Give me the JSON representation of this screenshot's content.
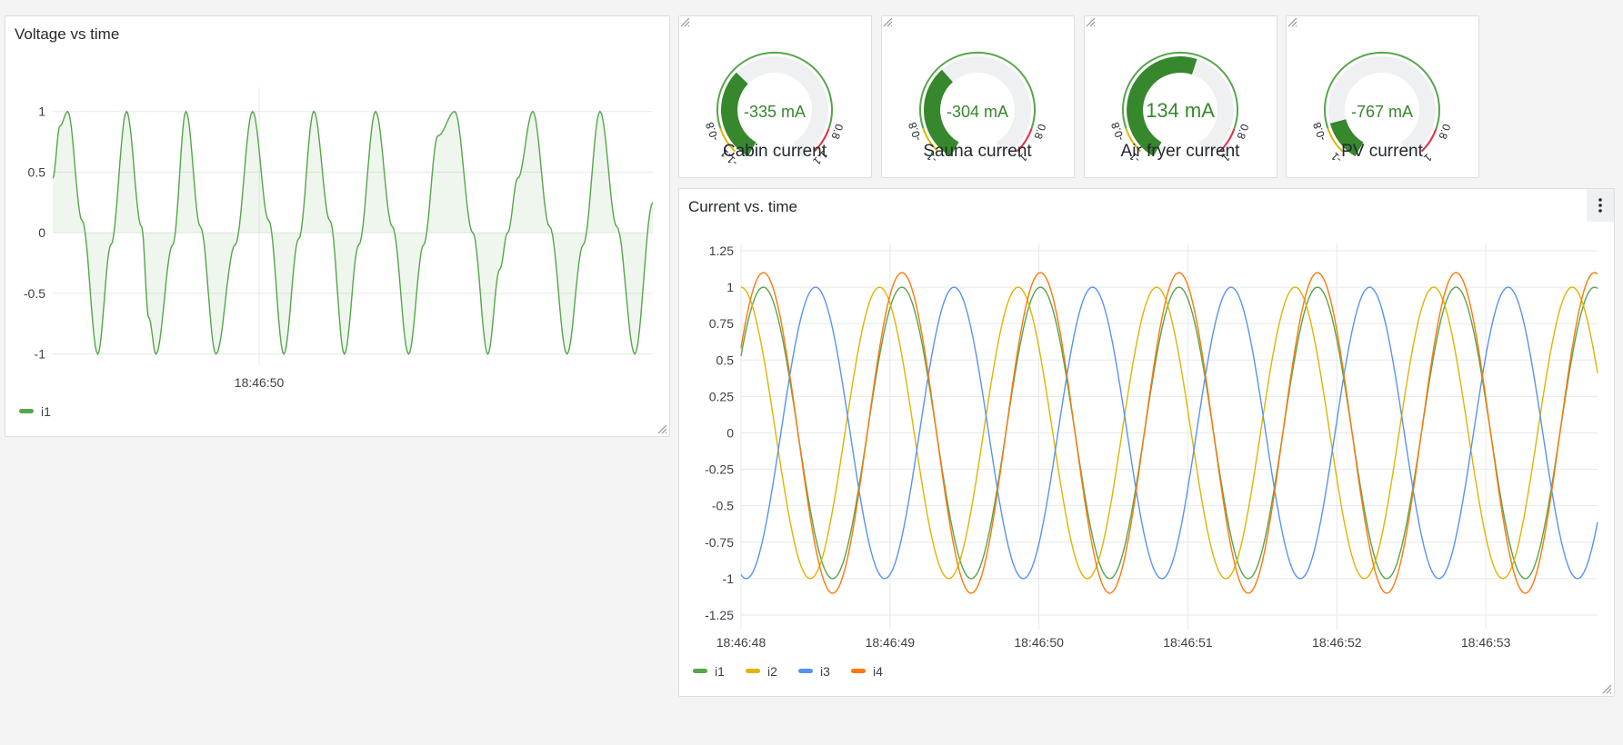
{
  "colors": {
    "green": "#56a64b",
    "green_dark": "#37872d",
    "yellow": "#e0b400",
    "blue": "#5794f2",
    "orange": "#ff780a",
    "red": "#e02f44",
    "grid": "#e6e8ea",
    "axis_text": "#3d4147",
    "gauge_track": "#eef0f1"
  },
  "voltage_panel": {
    "title": "Voltage vs time",
    "legend": [
      {
        "name": "i1",
        "color": "#56a64b"
      }
    ],
    "chart_data": {
      "type": "area",
      "title": "Voltage vs time",
      "xlim": [
        0,
        1
      ],
      "ylim": [
        -1.1,
        1.2
      ],
      "yticks": [
        {
          "value": 1,
          "label": "1"
        },
        {
          "value": 0.5,
          "label": "0.5"
        },
        {
          "value": 0,
          "label": "0"
        },
        {
          "value": -0.5,
          "label": "-0.5"
        },
        {
          "value": -1,
          "label": "-1"
        }
      ],
      "xticks": [
        {
          "value": 0.344,
          "label": "18:46:50"
        }
      ],
      "series": [
        {
          "name": "i1",
          "color": "#56a64b",
          "fill": true,
          "x": [
            0.0,
            0.012,
            0.025,
            0.049,
            0.075,
            0.097,
            0.123,
            0.148,
            0.16,
            0.172,
            0.2,
            0.222,
            0.246,
            0.272,
            0.304,
            0.333,
            0.36,
            0.385,
            0.41,
            0.435,
            0.462,
            0.486,
            0.51,
            0.538,
            0.566,
            0.593,
            0.618,
            0.642,
            0.67,
            0.7,
            0.725,
            0.745,
            0.758,
            0.775,
            0.8,
            0.828,
            0.857,
            0.884,
            0.912,
            0.94,
            0.97,
            1.0
          ],
          "y": [
            0.45,
            0.88,
            1.0,
            0.1,
            -1.0,
            -0.1,
            1.0,
            0.05,
            -0.7,
            -1.0,
            -0.1,
            1.0,
            0.05,
            -1.0,
            -0.1,
            1.0,
            0.1,
            -1.0,
            -0.05,
            1.0,
            0.1,
            -1.0,
            -0.1,
            1.0,
            0.05,
            -1.0,
            -0.1,
            0.8,
            1.0,
            0.0,
            -1.0,
            -0.3,
            0.0,
            0.45,
            1.0,
            0.05,
            -1.0,
            -0.1,
            1.0,
            0.05,
            -1.0,
            0.25
          ]
        }
      ]
    }
  },
  "gauges": [
    {
      "label": "Cabin current",
      "value_text": "-335 mA",
      "value": -335,
      "left_ticks": [
        "-1.1",
        "-0.8"
      ],
      "right_ticks": [
        "0.8",
        "1.1"
      ]
    },
    {
      "label": "Sauna current",
      "value_text": "-304 mA",
      "value": -304,
      "left_ticks": [
        "-1",
        "-0.8"
      ],
      "right_ticks": [
        "0.8",
        "1"
      ]
    },
    {
      "label": "Air fryer current",
      "value_text": "134 mA",
      "value": 134,
      "left_ticks": [
        "-1",
        "-0.8"
      ],
      "right_ticks": [
        "0.8",
        "1"
      ]
    },
    {
      "label": "PV current",
      "value_text": "-767 mA",
      "value": -767,
      "left_ticks": [
        "-1",
        "-0.8"
      ],
      "right_ticks": [
        "0.8",
        "1"
      ]
    }
  ],
  "gauge_range": {
    "min": -1100,
    "max": 1100,
    "yellow_from": -1000,
    "yellow_to": -800,
    "red_from": 800,
    "red_to": 1000
  },
  "current_panel": {
    "title": "Current vs. time",
    "legend": [
      {
        "name": "i1",
        "color": "#56a64b"
      },
      {
        "name": "i2",
        "color": "#e0b400"
      },
      {
        "name": "i3",
        "color": "#5794f2"
      },
      {
        "name": "i4",
        "color": "#ff780a"
      }
    ],
    "chart_data": {
      "type": "line",
      "title": "Current vs. time",
      "xlim": [
        0,
        5.75
      ],
      "ylim": [
        -1.35,
        1.3
      ],
      "yticks": [
        {
          "value": 1.25,
          "label": "1.25"
        },
        {
          "value": 1,
          "label": "1"
        },
        {
          "value": 0.75,
          "label": "0.75"
        },
        {
          "value": 0.5,
          "label": "0.5"
        },
        {
          "value": 0.25,
          "label": "0.25"
        },
        {
          "value": 0,
          "label": "0"
        },
        {
          "value": -0.25,
          "label": "-0.25"
        },
        {
          "value": -0.5,
          "label": "-0.5"
        },
        {
          "value": -0.75,
          "label": "-0.75"
        },
        {
          "value": -1,
          "label": "-1"
        },
        {
          "value": -1.25,
          "label": "-1.25"
        }
      ],
      "xticks": [
        {
          "value": 0,
          "label": "18:46:48"
        },
        {
          "value": 1,
          "label": "18:46:49"
        },
        {
          "value": 2,
          "label": "18:46:50"
        },
        {
          "value": 3,
          "label": "18:46:51"
        },
        {
          "value": 4,
          "label": "18:46:52"
        },
        {
          "value": 5,
          "label": "18:46:53"
        }
      ],
      "series": [
        {
          "name": "i1",
          "color": "#56a64b",
          "period": 0.93,
          "amplitude": 1.0,
          "peak_at": 0.15
        },
        {
          "name": "i2",
          "color": "#e0b400",
          "period": 0.93,
          "amplitude": 1.0,
          "peak_at": 0.0
        },
        {
          "name": "i3",
          "color": "#5794f2",
          "period": 0.93,
          "amplitude": 1.0,
          "peak_at": 0.5
        },
        {
          "name": "i4",
          "color": "#ff780a",
          "period": 0.93,
          "amplitude": 1.1,
          "peak_at": 0.15
        }
      ]
    }
  }
}
